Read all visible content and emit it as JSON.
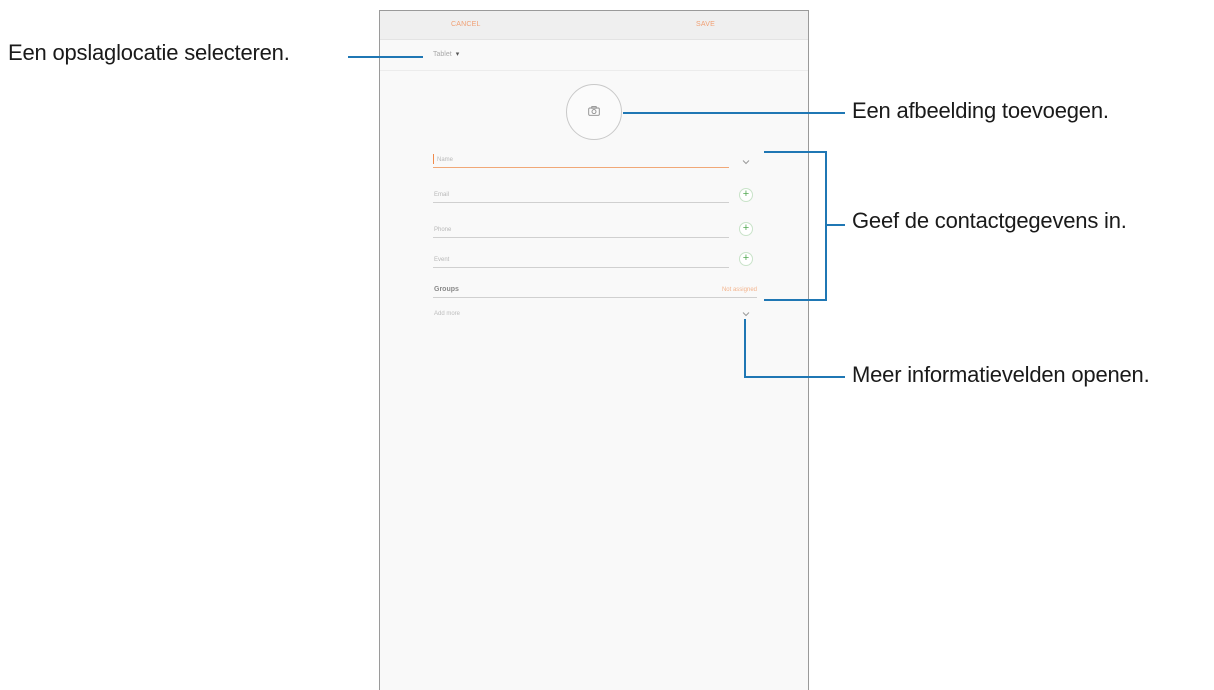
{
  "screen": {
    "header": {
      "cancel_label": "CANCEL",
      "save_label": "SAVE"
    },
    "storage": {
      "selected": "Tablet"
    },
    "fields": [
      {
        "placeholder": "Name"
      },
      {
        "placeholder": "Email"
      },
      {
        "placeholder": "Phone"
      },
      {
        "placeholder": "Event"
      }
    ],
    "groups": {
      "label": "Groups",
      "value": "Not assigned"
    },
    "add_more_label": "Add more"
  },
  "callouts": {
    "storage": "Een opslaglocatie selecteren.",
    "image": "Een afbeelding toevoegen.",
    "details": "Geef de contactgegevens in.",
    "more": "Meer informatievelden openen."
  },
  "colors": {
    "accent": "#f0a074",
    "leader": "#1f77b4",
    "add_icon": "#54a954"
  }
}
